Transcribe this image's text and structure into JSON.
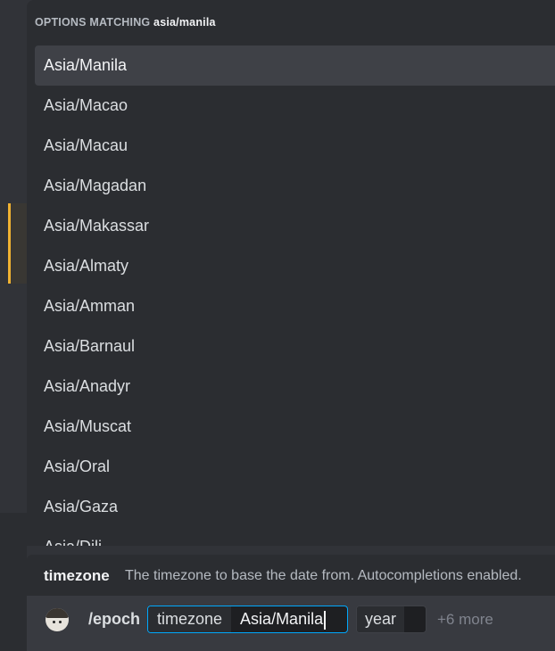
{
  "popup": {
    "header_prefix": "OPTIONS MATCHING",
    "header_query": "asia/manila",
    "options": [
      "Asia/Manila",
      "Asia/Macao",
      "Asia/Macau",
      "Asia/Magadan",
      "Asia/Makassar",
      "Asia/Almaty",
      "Asia/Amman",
      "Asia/Barnaul",
      "Asia/Anadyr",
      "Asia/Muscat",
      "Asia/Oral",
      "Asia/Gaza",
      "Asia/Dili"
    ]
  },
  "hint": {
    "param_name": "timezone",
    "description": "The timezone to base the date from. Autocompletions enabled."
  },
  "input": {
    "command": "/epoch",
    "active_param_label": "timezone",
    "active_param_value": "Asia/Manila",
    "next_param_label": "year",
    "more_label": "+6 more"
  },
  "colors": {
    "accent_focus": "#00a8fc",
    "accent_left_bar": "#f0b232",
    "popup_bg": "#2b2d31",
    "input_bg": "#383a40"
  }
}
